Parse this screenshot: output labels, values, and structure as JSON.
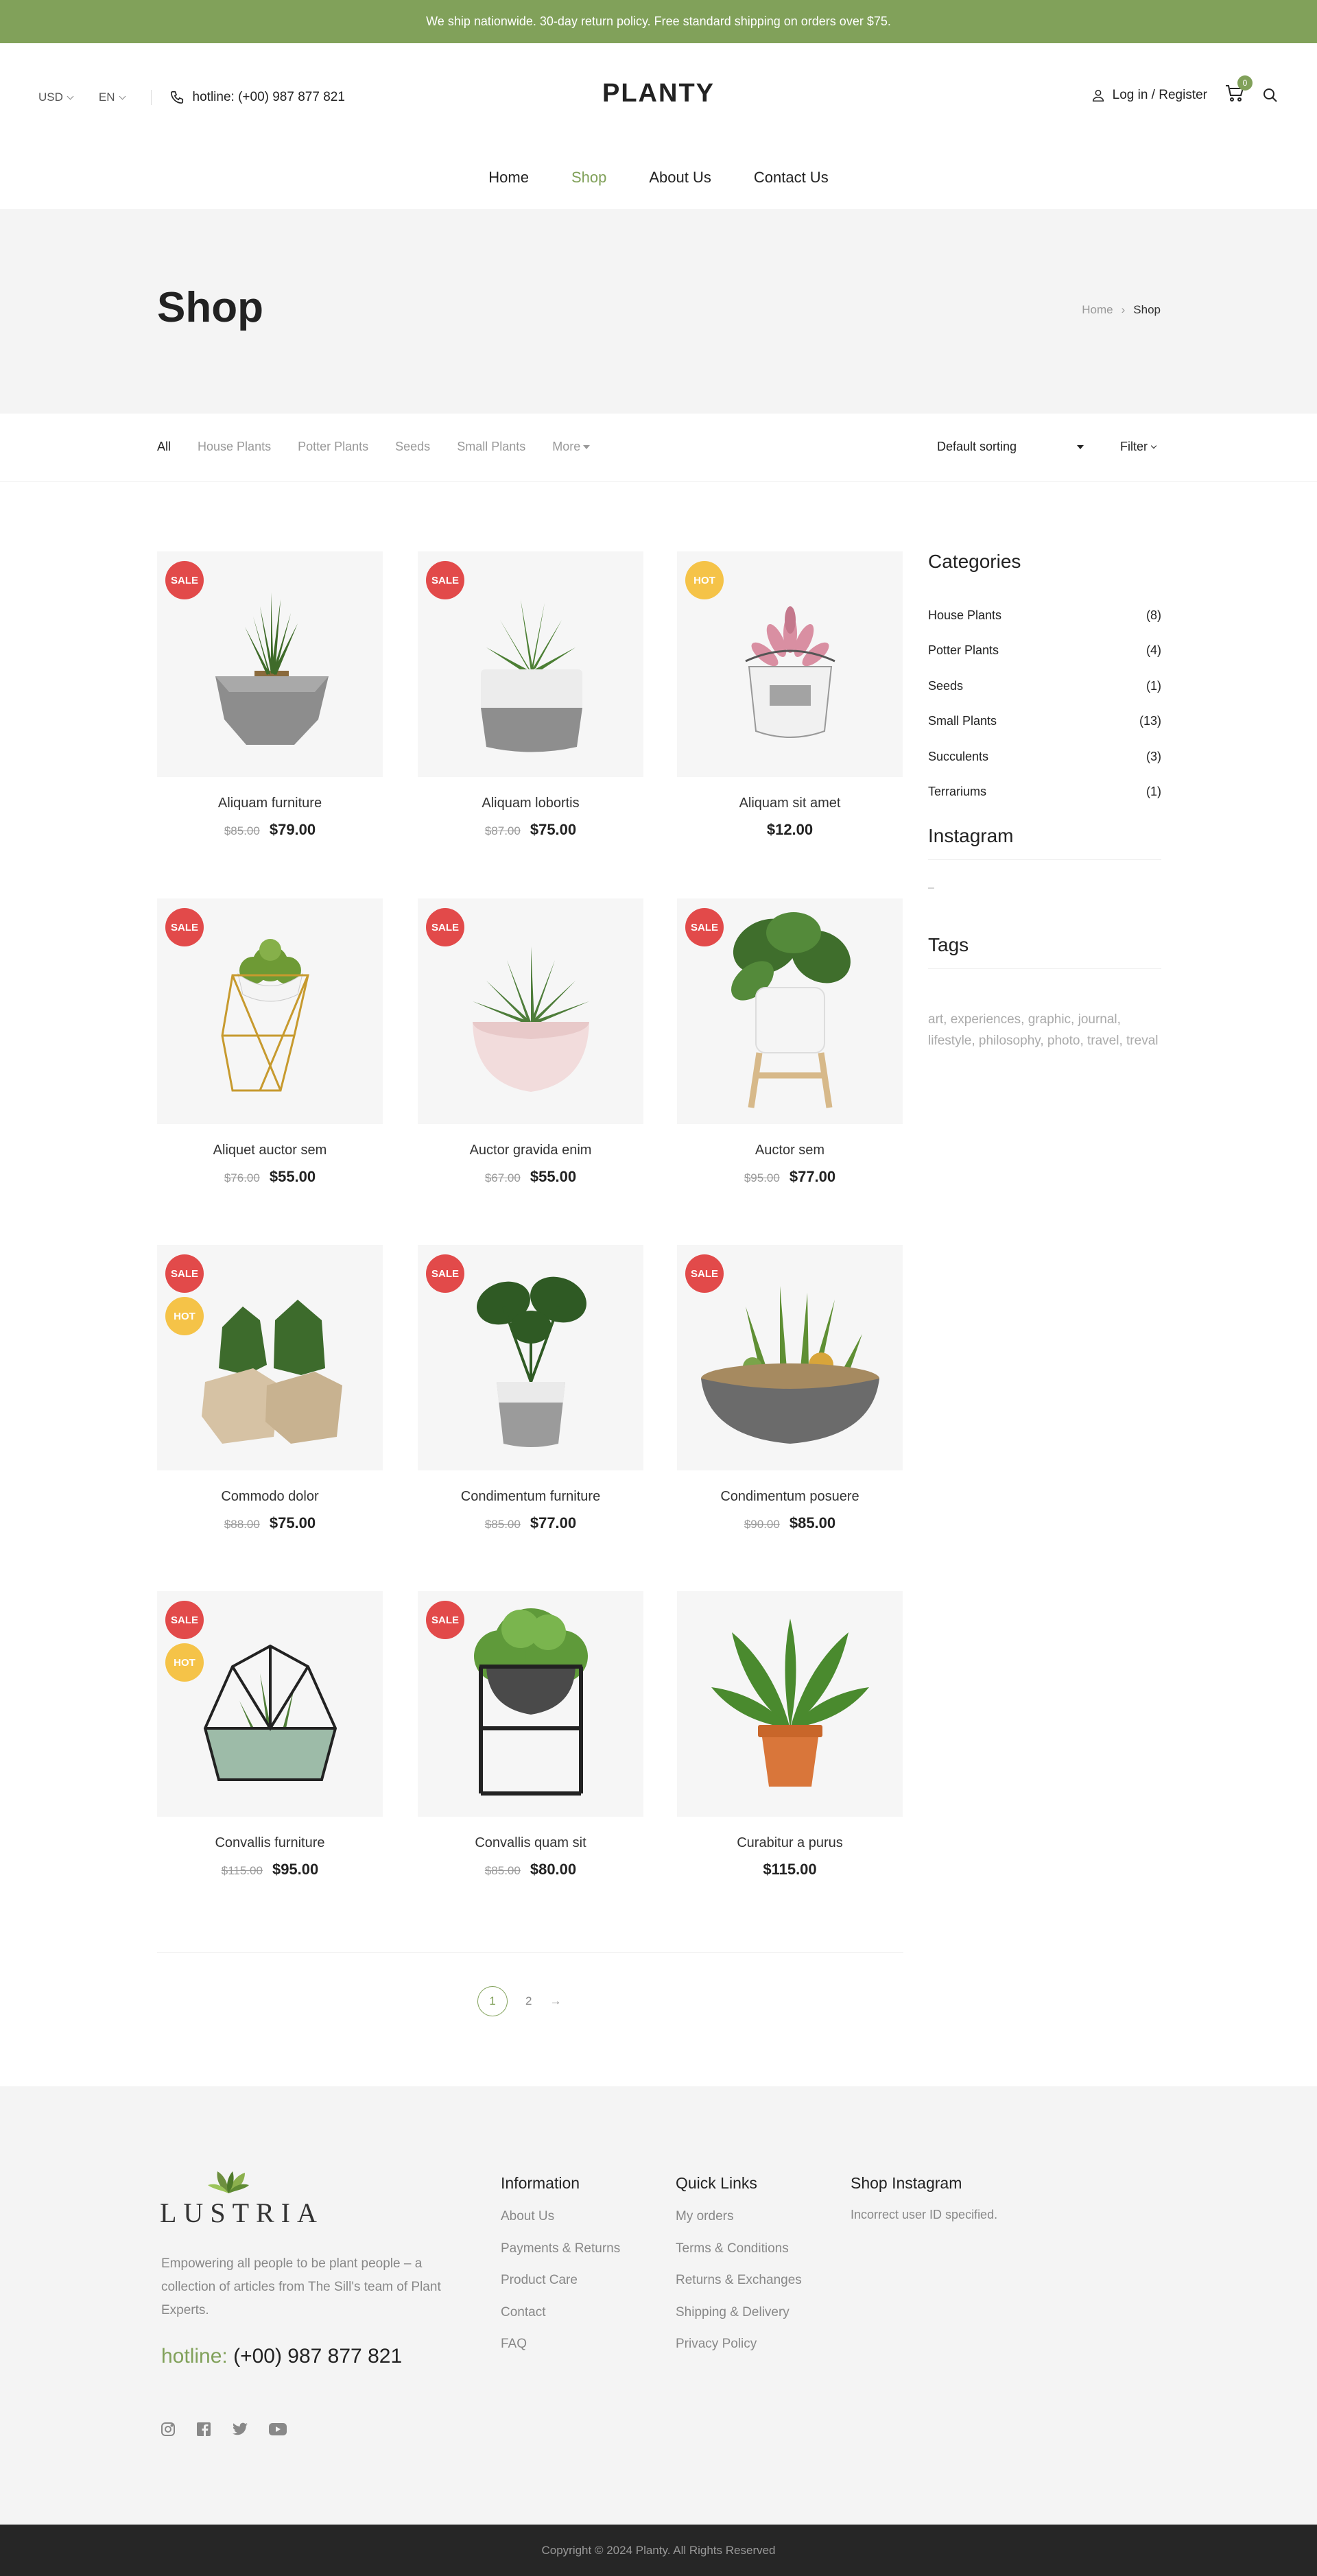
{
  "topbar": {
    "text": "We ship nationwide. 30-day return policy. Free standard shipping on orders over $75."
  },
  "header": {
    "currency": "USD",
    "language": "EN",
    "hotline": "hotline: (+00) 987 877 821",
    "logo": "PLANTY",
    "login": "Log in / Register",
    "cart_count": "0",
    "icons": {
      "phone": "phone-icon",
      "user": "user-icon",
      "cart": "cart-icon",
      "search": "search-icon"
    }
  },
  "nav": {
    "items": [
      "Home",
      "Shop",
      "About Us",
      "Contact Us"
    ],
    "active": "Shop"
  },
  "page": {
    "title": "Shop",
    "breadcrumb": [
      "Home",
      "Shop"
    ]
  },
  "filters": {
    "categories": [
      "All",
      "House Plants",
      "Potter Plants",
      "Seeds",
      "Small Plants",
      "More"
    ],
    "active": "All",
    "sorting": "Default sorting",
    "filter_label": "Filter"
  },
  "products": [
    {
      "name": "Aliquam furniture",
      "old_price": "$85.00",
      "price": "$79.00",
      "tags": [
        "SALE"
      ]
    },
    {
      "name": "Aliquam lobortis",
      "old_price": "$87.00",
      "price": "$75.00",
      "tags": [
        "SALE"
      ]
    },
    {
      "name": "Aliquam sit amet",
      "old_price": "",
      "price": "$12.00",
      "tags": [
        "HOT"
      ]
    },
    {
      "name": "Aliquet auctor sem",
      "old_price": "$76.00",
      "price": "$55.00",
      "tags": [
        "SALE"
      ]
    },
    {
      "name": "Auctor gravida enim",
      "old_price": "$67.00",
      "price": "$55.00",
      "tags": [
        "SALE"
      ]
    },
    {
      "name": "Auctor sem",
      "old_price": "$95.00",
      "price": "$77.00",
      "tags": [
        "SALE"
      ]
    },
    {
      "name": "Commodo dolor",
      "old_price": "$88.00",
      "price": "$75.00",
      "tags": [
        "SALE",
        "HOT"
      ]
    },
    {
      "name": "Condimentum furniture",
      "old_price": "$85.00",
      "price": "$77.00",
      "tags": [
        "SALE"
      ]
    },
    {
      "name": "Condimentum posuere",
      "old_price": "$90.00",
      "price": "$85.00",
      "tags": [
        "SALE"
      ]
    },
    {
      "name": "Convallis furniture",
      "old_price": "$115.00",
      "price": "$95.00",
      "tags": [
        "SALE",
        "HOT"
      ]
    },
    {
      "name": "Convallis quam sit",
      "old_price": "$85.00",
      "price": "$80.00",
      "tags": [
        "SALE"
      ]
    },
    {
      "name": "Curabitur a purus",
      "old_price": "",
      "price": "$115.00",
      "tags": []
    }
  ],
  "sidebar": {
    "categories_title": "Categories",
    "categories": [
      {
        "name": "House Plants",
        "count": "(8)"
      },
      {
        "name": "Potter Plants",
        "count": "(4)"
      },
      {
        "name": "Seeds",
        "count": "(1)"
      },
      {
        "name": "Small Plants",
        "count": "(13)"
      },
      {
        "name": "Succulents",
        "count": "(3)"
      },
      {
        "name": "Terrariums",
        "count": "(1)"
      }
    ],
    "instagram_title": "Instagram",
    "instagram_placeholder": "–",
    "tags_title": "Tags",
    "tags": "art, experiences, graphic, journal, lifestyle, philosophy, photo, travel, treval"
  },
  "pagination": {
    "current": "1",
    "next": "2",
    "arrow": "→"
  },
  "footer": {
    "logo": "LUSTRIA",
    "description": "Empowering all people to be plant people – a collection of articles from The Sill's team of Plant Experts.",
    "hotline_label": "hotline:",
    "hotline_number": "(+00) 987 877 821",
    "social": [
      "instagram-icon",
      "facebook-icon",
      "twitter-icon",
      "youtube-icon"
    ],
    "information": {
      "title": "Information",
      "links": [
        "About Us",
        "Payments & Returns",
        "Product Care",
        "Contact",
        "FAQ"
      ]
    },
    "quick_links": {
      "title": "Quick Links",
      "links": [
        "My orders",
        "Terms & Conditions",
        "Returns & Exchanges",
        "Shipping & Delivery",
        "Privacy Policy"
      ]
    },
    "shop_instagram": {
      "title": "Shop Instagram",
      "text": "Incorrect user ID specified."
    },
    "copyright": "Copyright © 2024 Planty. All Rights Reserved"
  },
  "colors": {
    "accent": "#81a15a",
    "sale": "#e24a4a",
    "hot": "#f5c348",
    "footer_bottom": "#262626"
  }
}
